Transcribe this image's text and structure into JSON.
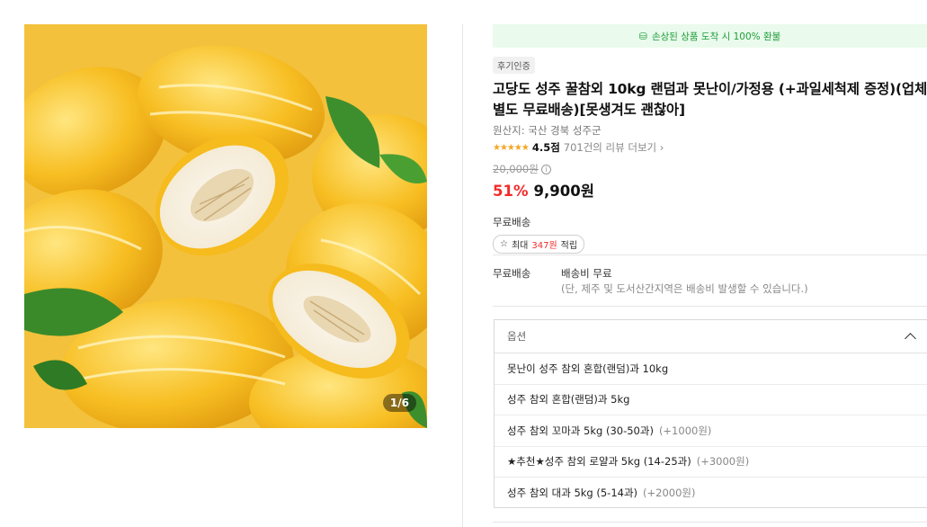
{
  "gallery": {
    "counter": "1/6"
  },
  "banner": {
    "refund_text": "손상된 상품 도착 시 100% 환불",
    "color": "#1f9d3a"
  },
  "product": {
    "badge": "후기인증",
    "title": "고당도 성주 꿀참외 10kg 랜덤과 못난이/가정용 (+과일세척제 증정)(업체별도 무료배송)[못생겨도 괜찮아]",
    "origin": "원산지: 국산 경북 성주군",
    "stars": "★★★★★",
    "rating": "4.5점",
    "reviews": "701건의 리뷰 더보기",
    "original_price": "20,000원",
    "discount": "51%",
    "price": "9,900원",
    "accent_color": "#f22b2b"
  },
  "shipping": {
    "label": "무료배송",
    "points_prefix": "최대",
    "points_value": "347원",
    "points_suffix": "적립",
    "detail_label": "무료배송",
    "detail_value": "배송비 무료",
    "detail_note": "(단, 제주 및 도서산간지역은 배송비 발생할 수 있습니다.)"
  },
  "options": {
    "header": "옵션",
    "items": [
      {
        "label": "못난이 성주 참외 혼합(랜덤)과 10kg",
        "extra": ""
      },
      {
        "label": "성주 참외 혼합(랜덤)과 5kg",
        "extra": ""
      },
      {
        "label": "성주 참외 꼬마과 5kg (30-50과)",
        "extra": "(+1000원)"
      },
      {
        "label": "★추천★성주 참외 로얄과 5kg (14-25과)",
        "extra": "(+3000원)"
      },
      {
        "label": "성주 참외 대과 5kg (5-14과)",
        "extra": "(+2000원)"
      }
    ]
  }
}
